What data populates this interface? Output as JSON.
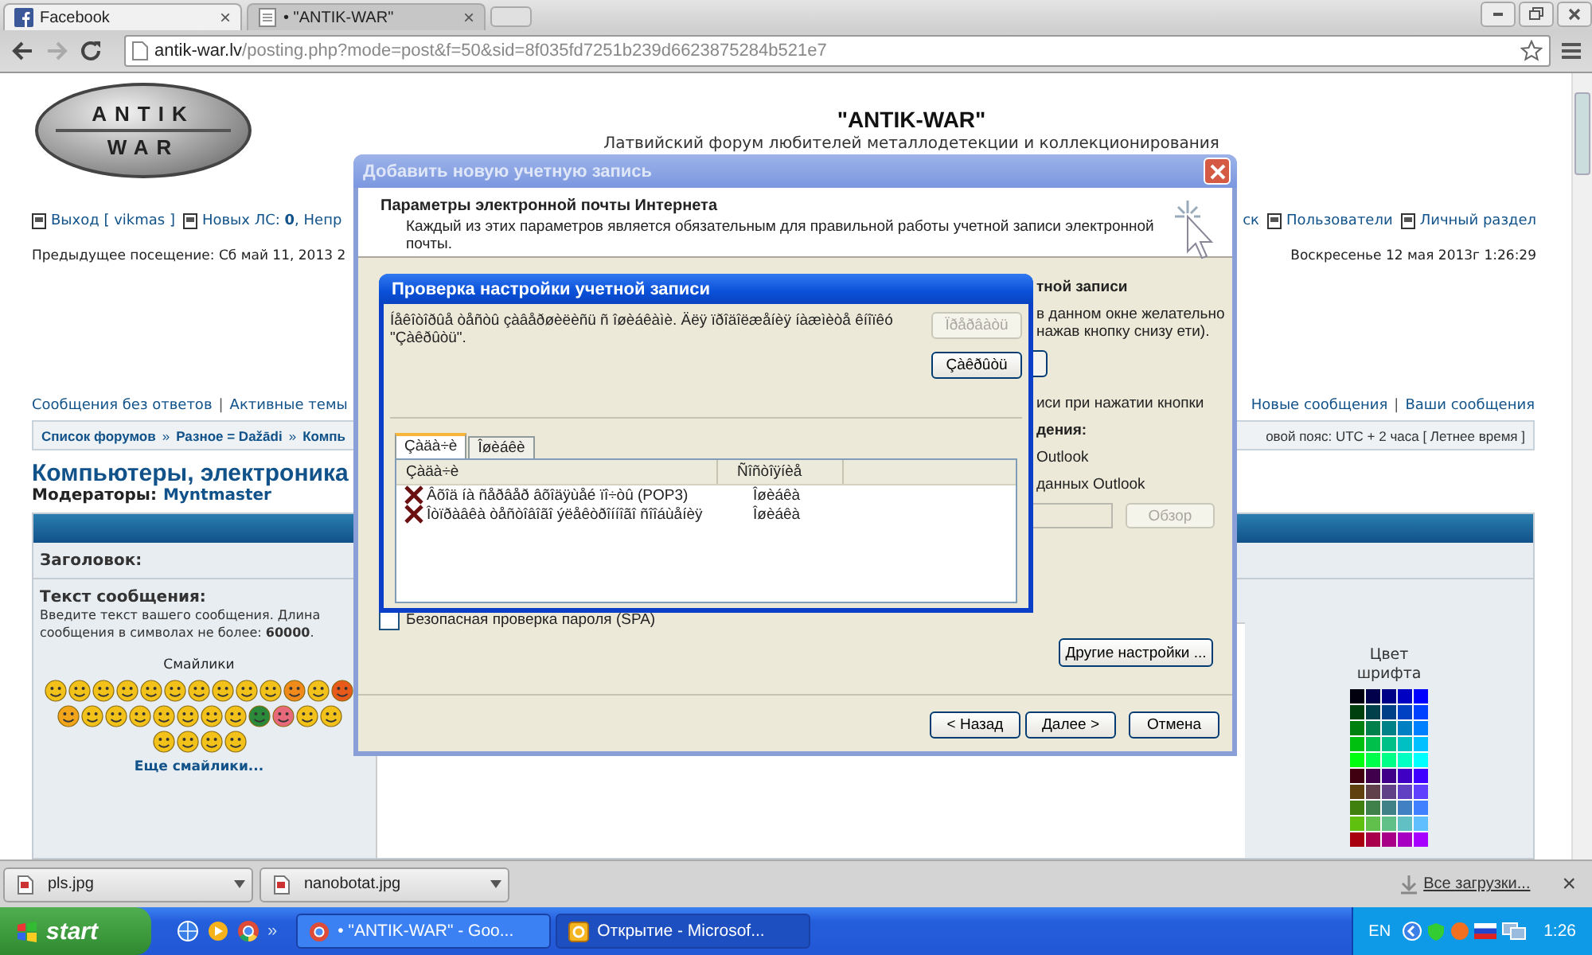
{
  "browser": {
    "tab_close": "×",
    "tabs": [
      {
        "label": "Facebook",
        "kind": "facebook",
        "selected": false
      },
      {
        "label": "• \"ANTIK-WAR\"",
        "kind": "page",
        "selected": true
      }
    ],
    "url_host": "antik-war.lv",
    "url_path": "/posting.php?mode=post&f=50&sid=8f035fd7251b239d6623875284b521e7"
  },
  "page": {
    "logo_top": "ANTIK",
    "logo_bottom": "WAR",
    "title": "\"ANTIK-WAR\"",
    "subtitle": "Латвийский форум любителей металлодетекции и коллекционирования",
    "nav_left": [
      {
        "label": "Выход [ vikmas ]",
        "kind": "link"
      },
      {
        "label": "Новых ЛС: **0**, Непр",
        "kind": "link"
      }
    ],
    "nav_right": [
      {
        "label": "ск",
        "kind": "plain"
      },
      {
        "label": "Пользователи",
        "kind": "link"
      },
      {
        "label": "Личный раздел",
        "kind": "link"
      }
    ],
    "last_visit": "Предыдущее посещение: Сб май 11, 2013 2",
    "current_time": "Воскресенье 12 мая 2013г 1:26:29",
    "links_left": [
      "Сообщения без ответов",
      "Активные темы"
    ],
    "links_right": [
      "Новые сообщения",
      "Ваши сообщения"
    ],
    "breadcrumbs": [
      "Список форумов",
      "Разное = Dažādi",
      "Компь"
    ],
    "timezone": "овой пояс: UTC + 2 часа [ Летнее время ]",
    "forum_title": "Компьютеры, электроника",
    "moderators_label": "Модераторы:",
    "moderator": "Myntmaster",
    "subject_label": "Заголовок:",
    "message_label": "Текст сообщения:",
    "message_hint": "Введите текст вашего сообщения. Длина сообщения в символах не более: **60000**.",
    "smileys_title": "Смайлики",
    "link_separator": "|",
    "crumb_separator": "»",
    "more_smileys": "Еще смайлики...",
    "font_color_label": "Цвет шрифта"
  },
  "dialog": {
    "title": "Добавить новую учетную запись",
    "header_title": "Параметры электронной почты Интернета",
    "header_text": "Каждый из этих параметров является обязательным для правильной работы учетной записи электронной почты.",
    "side_texts": [
      {
        "text": "тной записи",
        "kind": "bold"
      },
      {
        "text": "в данном окне желательно нажав кнопку снизу ети).",
        "kind": "plain"
      },
      {
        "kind": "button"
      },
      {
        "text": "иси при нажатии кнопки",
        "kind": "plain"
      },
      {
        "text": "дения:",
        "kind": "bold"
      },
      {
        "text": "Outlook",
        "kind": "plain"
      },
      {
        "text": "данных Outlook",
        "kind": "plain"
      }
    ],
    "browse_button": {
      "label": "Обзор",
      "disabled": true
    },
    "spa_checkbox": {
      "label": "Безопасная проверка пароля (SPA)",
      "checked": false
    },
    "more_settings": "Другие настройки ...",
    "buttons": [
      "< Назад",
      "Далее >",
      "Отмена"
    ]
  },
  "test_dialog": {
    "title": "Проверка настройки учетной записи",
    "message": "Íåêîòîðûå òåñòû çàâåðøèëèñü ñ îøèáêàìè. Äëÿ ïðîäîëæåíèÿ íàæìèòå êíîïêó \"Çàêðûòü\".",
    "buttons": [
      {
        "label": "Ïðåðâàòü",
        "disabled": true
      },
      {
        "label": "Çàêðûòü",
        "disabled": false
      }
    ],
    "tabs": [
      {
        "label": "Çàäà÷è",
        "selected": true
      },
      {
        "label": "Îøèáêè",
        "selected": false
      }
    ],
    "columns": [
      "Çàäà÷è",
      "Ñîñòîÿíèå"
    ],
    "rows": [
      {
        "task": "Âõîä íà ñåðâåð âõîäÿùåé ïî÷òû (POP3)",
        "status": "Îøèáêà",
        "failed": true
      },
      {
        "task": "Îòïðàâêà òåñòîâîãî ýëåêòðîííîãî ñîîáùåíèÿ",
        "status": "Îøèáêà",
        "failed": true
      }
    ]
  },
  "downloads": {
    "items": [
      "pls.jpg",
      "nanobotat.jpg"
    ],
    "all": "Все загрузки...",
    "close": "×"
  },
  "taskbar": {
    "start": "start",
    "tasks": [
      {
        "label": "• \"ANTIK-WAR\" - Goo...",
        "kind": "chrome",
        "selected": false
      },
      {
        "label": "Открытие - Microsof...",
        "kind": "outlook",
        "selected": true
      }
    ],
    "more": "»",
    "language": "EN",
    "clock": "1:26"
  }
}
